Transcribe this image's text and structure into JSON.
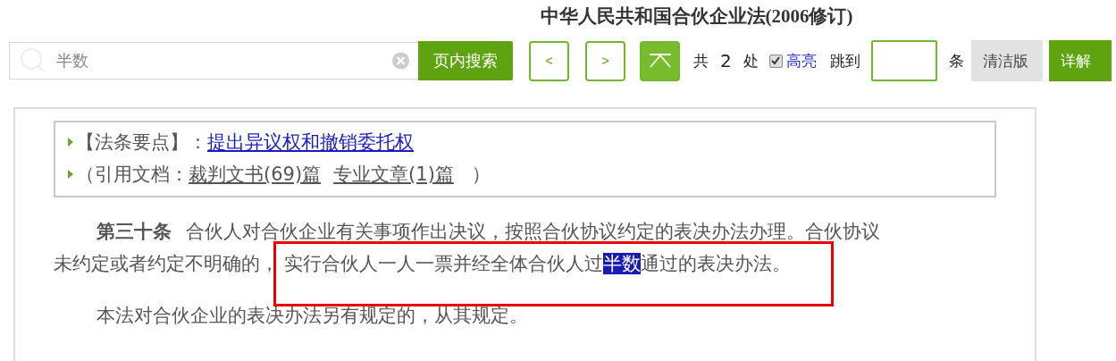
{
  "title": "中华人民共和国合伙企业法(2006修订)",
  "search": {
    "value": "半数",
    "button": "页内搜索"
  },
  "nav": {
    "prev": "<",
    "next": ">"
  },
  "count": {
    "prefix": "共",
    "number": "2",
    "suffix": "处"
  },
  "highlight_toggle": {
    "label": "高亮",
    "checked": true
  },
  "jump": {
    "label": "跳到",
    "unit": "条"
  },
  "versions": [
    {
      "label": "清洁版",
      "selected": false
    },
    {
      "label": "详解",
      "selected": true
    }
  ],
  "summary": {
    "points_label": "【法条要点】：",
    "points_link": "提出异议权和撤销委托权",
    "refs_open": "（引用文档：",
    "refs": [
      "裁判文书(69)篇",
      "专业文章(1)篇"
    ],
    "refs_close": "）"
  },
  "article": {
    "number": "第三十条",
    "line_1": "合伙人对合伙企业有关事项作出决议，按照合伙协议约定的表决办法办理。合伙协议",
    "line_2_start": "未约定或者约定不明确的，",
    "line_2_marked": "实行合伙人一人一票并经全体合伙人过",
    "match": "半数",
    "line_2_end": "通过的表决办法。"
  },
  "paragraph_2": "本法对合伙企业的表决办法另有规定的，从其规定。"
}
